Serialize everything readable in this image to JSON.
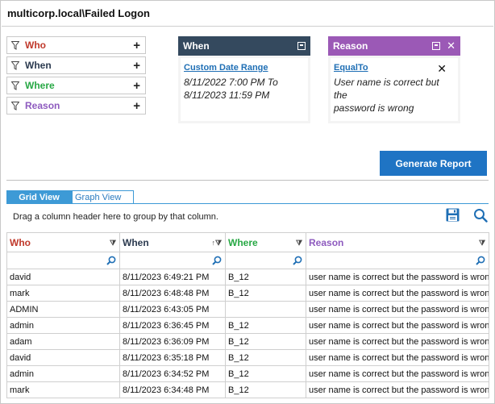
{
  "header": {
    "title": "multicorp.local\\Failed Logon"
  },
  "filters": [
    {
      "label": "Who",
      "color": "#c0392b"
    },
    {
      "label": "When",
      "color": "#2b3a4f"
    },
    {
      "label": "Where",
      "color": "#27a844"
    },
    {
      "label": "Reason",
      "color": "#8e5bbf"
    }
  ],
  "when_card": {
    "title": "When",
    "header_color": "#34495e",
    "link": "Custom Date Range",
    "line1": "8/11/2022 7:00 PM To",
    "line2": "8/11/2023 11:59 PM"
  },
  "reason_card": {
    "title": "Reason",
    "header_color": "#9b59b6",
    "link": "EqualTo",
    "line1": "User name is correct but the",
    "line2": "password is wrong"
  },
  "actions": {
    "generate_label": "Generate Report"
  },
  "tabs": [
    {
      "label": "Grid View",
      "active": true
    },
    {
      "label": "Graph View",
      "active": false
    }
  ],
  "grid": {
    "group_hint": "Drag a column header here to group by that column.",
    "columns": [
      "Who",
      "When",
      "Where",
      "Reason"
    ],
    "rows": [
      [
        "david",
        "8/11/2023 6:49:21 PM",
        "B_12",
        "user name is correct but the password is wrong"
      ],
      [
        "mark",
        "8/11/2023 6:48:48 PM",
        "B_12",
        "user name is correct but the password is wrong"
      ],
      [
        "ADMIN",
        "8/11/2023 6:43:05 PM",
        "",
        "user name is correct but the password is wrong"
      ],
      [
        "admin",
        "8/11/2023 6:36:45 PM",
        "B_12",
        "user name is correct but the password is wrong"
      ],
      [
        "adam",
        "8/11/2023 6:36:09 PM",
        "B_12",
        "user name is correct but the password is wrong"
      ],
      [
        "david",
        "8/11/2023 6:35:18 PM",
        "B_12",
        "user name is correct but the password is wrong"
      ],
      [
        "admin",
        "8/11/2023 6:34:52 PM",
        "B_12",
        "user name is correct but the password is wrong"
      ],
      [
        "mark",
        "8/11/2023 6:34:48 PM",
        "B_12",
        "user name is correct but the password is wrong"
      ]
    ]
  }
}
